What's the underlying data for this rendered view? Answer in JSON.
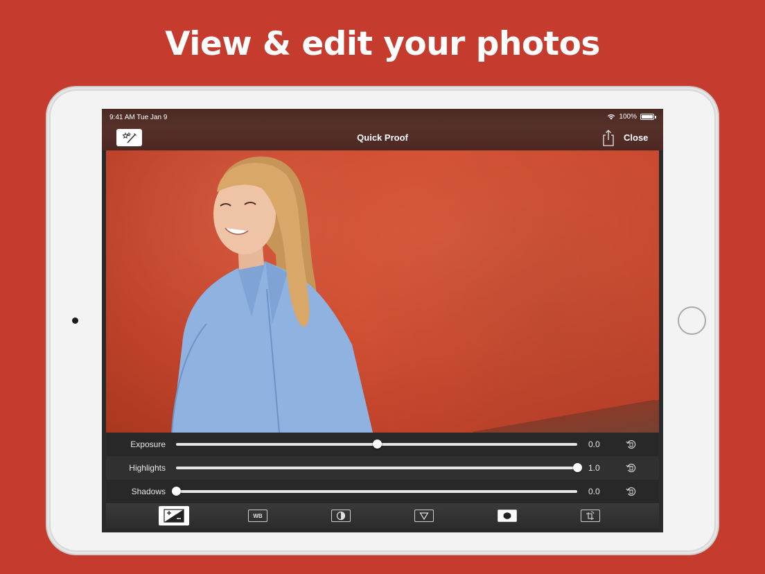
{
  "headline": "View & edit your photos",
  "status_bar": {
    "time": "9:41 AM  Tue Jan 9",
    "battery": "100%"
  },
  "nav": {
    "title": "Quick Proof",
    "close_label": "Close"
  },
  "adjustments": [
    {
      "label": "Exposure",
      "value": "0.0",
      "position": 0.5
    },
    {
      "label": "Highlights",
      "value": "1.0",
      "position": 1.0
    },
    {
      "label": "Shadows",
      "value": "0.0",
      "position": 0.0
    }
  ],
  "toolbar": {
    "tools": [
      {
        "name": "exposure-icon",
        "label": "",
        "active": true
      },
      {
        "name": "white-balance-icon",
        "label": "WB",
        "active": false
      },
      {
        "name": "contrast-icon",
        "label": "",
        "active": false
      },
      {
        "name": "filter-icon",
        "label": "",
        "active": false
      },
      {
        "name": "vignette-icon",
        "label": "",
        "active": false
      },
      {
        "name": "crop-rotate-icon",
        "label": "",
        "active": false
      }
    ]
  },
  "colors": {
    "background": "#c53c2f",
    "nav_bar": "#4d2822",
    "photo_wall": "#cf4f33",
    "shirt": "#8fb2e0",
    "hair": "#d9a768"
  }
}
